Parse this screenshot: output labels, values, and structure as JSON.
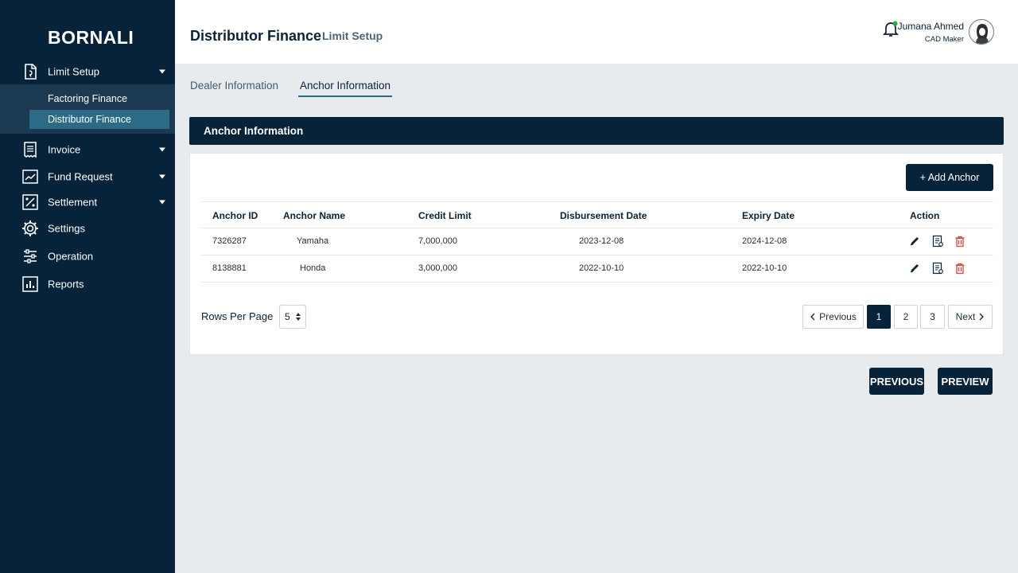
{
  "brand": "BORNALI",
  "sidebar": {
    "items": [
      {
        "label": "Limit Setup",
        "icon": "document-icon"
      },
      {
        "label": "Invoice",
        "icon": "receipt-icon"
      },
      {
        "label": "Fund Request",
        "icon": "chart-line-icon"
      },
      {
        "label": "Settlement",
        "icon": "percent-icon"
      },
      {
        "label": "Settings",
        "icon": "gear-icon"
      },
      {
        "label": "Operation",
        "icon": "sliders-icon"
      },
      {
        "label": "Reports",
        "icon": "bar-chart-icon"
      }
    ],
    "sub_items": [
      {
        "label": "Factoring Finance"
      },
      {
        "label": "Distributor Finance"
      }
    ]
  },
  "header": {
    "title": "Distributor Finance",
    "subtitle": "Limit Setup",
    "user_name": "Jumana Ahmed",
    "user_role": "CAD Maker"
  },
  "tabs": [
    {
      "label": "Dealer Information"
    },
    {
      "label": "Anchor Information"
    }
  ],
  "section": {
    "title": "Anchor Information"
  },
  "add_button": "+ Add Anchor",
  "table": {
    "headers": [
      "Anchor ID",
      "Anchor Name",
      "Credit Limit",
      "Disbursement Date",
      "Expiry Date",
      "Action"
    ],
    "rows": [
      {
        "id": "7326287",
        "name": "Yamaha",
        "limit": "7,000,000",
        "disbursement": "2023-12-08",
        "expiry": "2024-12-08"
      },
      {
        "id": "8138881",
        "name": "Honda",
        "limit": "3,000,000",
        "disbursement": "2022-10-10",
        "expiry": "2022-10-10"
      }
    ]
  },
  "pagination": {
    "rows_label": "Rows Per Page",
    "rows_value": "5",
    "previous": "Previous",
    "pages": [
      "1",
      "2",
      "3"
    ],
    "next": "Next"
  },
  "footer": {
    "previous": "PREVIOUS",
    "preview": "PREVIEW"
  },
  "colors": {
    "sidebar": "#07233a",
    "accent": "#2b6b85",
    "delete": "#e0413a",
    "online": "#2aa84a"
  }
}
